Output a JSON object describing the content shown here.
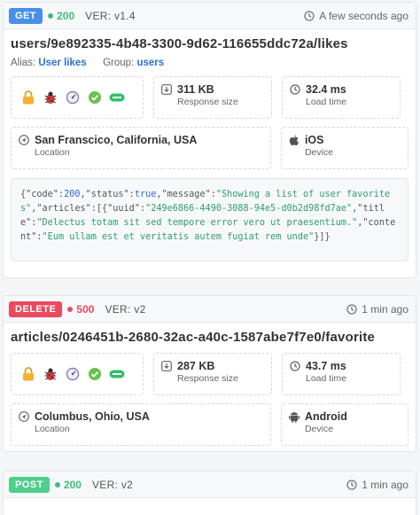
{
  "requests": [
    {
      "method": "GET",
      "status": "200",
      "version": "VER: v1.4",
      "time": "A few seconds ago",
      "url": "users/9e892335-4b48-3300-9d62-116655ddc72a/likes",
      "alias_label": "Alias:",
      "alias_value": "User likes",
      "group_label": "Group:",
      "group_value": "users",
      "size": "311 KB",
      "size_label": "Response size",
      "load": "32.4 ms",
      "load_label": "Load time",
      "location": "San Franscico, California, USA",
      "location_label": "Location",
      "device": "iOS",
      "device_label": "Device",
      "json_parts": {
        "p1": "{\"code\":",
        "code": "200",
        "p2": ",\"status\":",
        "statusv": "true",
        "p3": ",\"message\":",
        "message": "\"Showing a list of user favorites\"",
        "p4": ",\"articles\":[{\"uuid\":",
        "uuid": "\"249e6866-4490-3088-94e5-d0b2d98fd7ae\"",
        "p5": ",\"title\":",
        "title": "\"Delectus totam sit sed tempore error vero ut praesentium.\"",
        "p6": ",\"content\":",
        "content": "\"Eum ullam est et veritatis autem fugiat rem unde\"",
        "p7": "}]}"
      }
    },
    {
      "method": "DELETE",
      "status": "500",
      "version": "VER: v2",
      "time": "1 min ago",
      "url": "articles/0246451b-2680-32ac-a40c-1587abe7f7e0/favorite",
      "size": "287 KB",
      "size_label": "Response size",
      "load": "43.7 ms",
      "load_label": "Load time",
      "location": "Columbus, Ohio, USA",
      "location_label": "Location",
      "device": "Android",
      "device_label": "Device"
    },
    {
      "method": "POST",
      "status": "200",
      "version": "VER: v2",
      "time": "1 min ago"
    }
  ],
  "colors": {
    "get": "#4a8fe7",
    "delete": "#e84b5f",
    "post": "#4fcf8e",
    "ok": "#3fbe7a",
    "error": "#e84b5f",
    "link": "#2c6fd6"
  },
  "icons": [
    "lock-icon",
    "bug-icon",
    "gauge-icon",
    "check-badge-icon",
    "minus-pill-icon"
  ]
}
